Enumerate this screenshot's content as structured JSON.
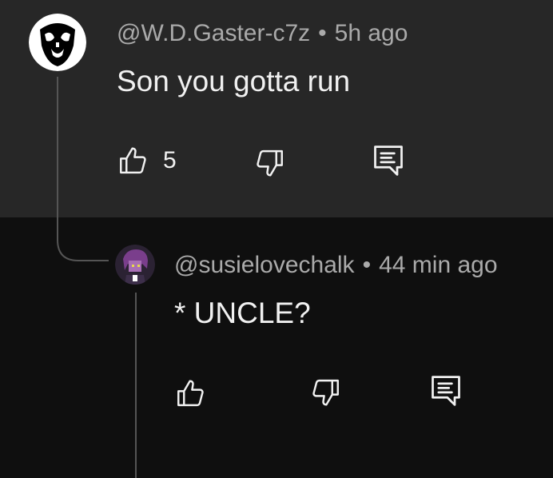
{
  "comment": {
    "author": "@W.D.Gaster-c7z",
    "separator": "•",
    "time": "5h ago",
    "text": "Son you gotta run",
    "like_count": "5",
    "icons": {
      "avatar": "gaster-avatar",
      "like": "thumbs-up-icon",
      "dislike": "thumbs-down-icon",
      "reply": "reply-icon"
    }
  },
  "reply": {
    "author": "@susielovechalk",
    "separator": "•",
    "time": "44 min ago",
    "text": "* UNCLE?",
    "icons": {
      "avatar": "susie-avatar",
      "like": "thumbs-up-icon",
      "dislike": "thumbs-down-icon",
      "reply": "reply-icon"
    }
  },
  "colors": {
    "top_background": "#272727",
    "reply_background": "#0f0f0f",
    "meta_text": "#aaaaaa",
    "body_text": "#f1f1f1",
    "thread_line": "#555555"
  }
}
